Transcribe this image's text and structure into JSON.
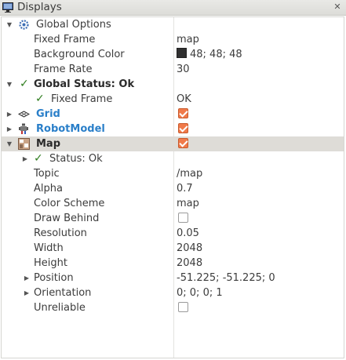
{
  "window": {
    "title": "Displays",
    "close_glyph": "✕"
  },
  "global_options": {
    "label": "Global Options",
    "fixed_frame": {
      "label": "Fixed Frame",
      "value": "map"
    },
    "background_color": {
      "label": "Background Color",
      "value": "48; 48; 48",
      "swatch": "#303030"
    },
    "frame_rate": {
      "label": "Frame Rate",
      "value": "30"
    }
  },
  "global_status": {
    "label": "Global Status: Ok",
    "fixed_frame": {
      "label": "Fixed Frame",
      "value": "OK"
    }
  },
  "grid": {
    "label": "Grid",
    "enabled": true
  },
  "robot_model": {
    "label": "RobotModel",
    "enabled": true
  },
  "map": {
    "label": "Map",
    "enabled": true,
    "status": {
      "label": "Status: Ok"
    },
    "topic": {
      "label": "Topic",
      "value": "/map"
    },
    "alpha": {
      "label": "Alpha",
      "value": "0.7"
    },
    "color_scheme": {
      "label": "Color Scheme",
      "value": "map"
    },
    "draw_behind": {
      "label": "Draw Behind",
      "checked": false
    },
    "resolution": {
      "label": "Resolution",
      "value": "0.05"
    },
    "width": {
      "label": "Width",
      "value": "2048"
    },
    "height": {
      "label": "Height",
      "value": "2048"
    },
    "position": {
      "label": "Position",
      "value": "-51.225; -51.225; 0"
    },
    "orientation": {
      "label": "Orientation",
      "value": "0; 0; 0; 1"
    },
    "unreliable": {
      "label": "Unreliable",
      "checked": false
    }
  },
  "icons": {
    "window": "monitor-icon",
    "global_options": "gear-icon",
    "status_ok": "checkmark-icon",
    "grid": "grid-icon",
    "robot_model": "robot-icon",
    "map": "map-icon"
  },
  "colors": {
    "status_ok": "#2e7d1e",
    "plugin_name": "#2a7fc9",
    "checkbox_on": "#f07a4a"
  }
}
